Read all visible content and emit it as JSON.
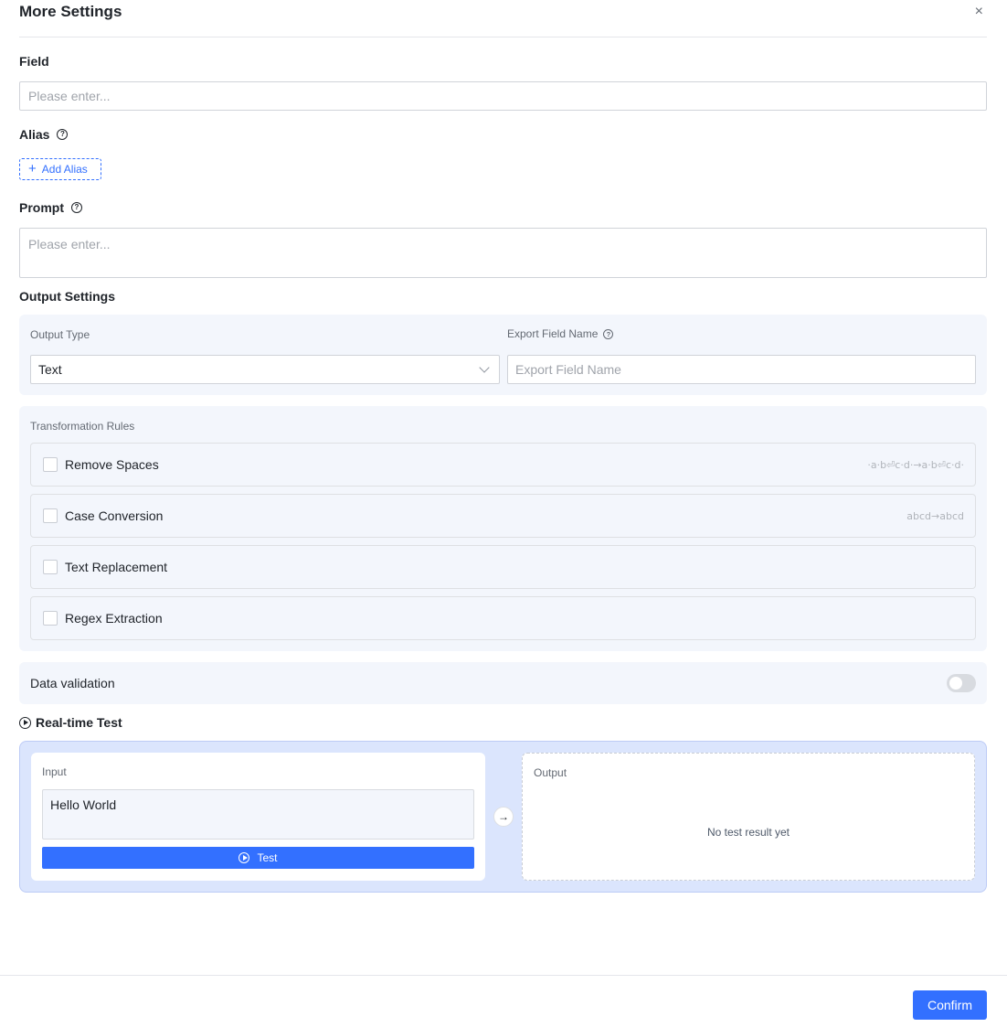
{
  "dialog": {
    "title": "More Settings",
    "close_glyph": "×"
  },
  "field": {
    "label": "Field",
    "placeholder": "Please enter..."
  },
  "alias": {
    "label": "Alias",
    "add_button": "Add Alias"
  },
  "prompt": {
    "label": "Prompt",
    "placeholder": "Please enter..."
  },
  "output_settings": {
    "label": "Output Settings",
    "output_type_label": "Output Type",
    "output_type_value": "Text",
    "export_field_label": "Export Field Name",
    "export_field_placeholder": "Export Field Name"
  },
  "transformation": {
    "label": "Transformation Rules",
    "rules": [
      {
        "label": "Remove Spaces",
        "hint": "·a·b⏎c·d·→a·b⏎c·d·",
        "checked": false
      },
      {
        "label": "Case Conversion",
        "hint": "abcd→abcd",
        "checked": false
      },
      {
        "label": "Text Replacement",
        "hint": "",
        "checked": false
      },
      {
        "label": "Regex Extraction",
        "hint": "",
        "checked": false
      }
    ]
  },
  "validation": {
    "label": "Data validation",
    "enabled": false
  },
  "realtime_test": {
    "title": "Real-time Test",
    "input_label": "Input",
    "input_value": "Hello World",
    "test_button": "Test",
    "output_label": "Output",
    "empty_text": "No test result yet"
  },
  "footer": {
    "confirm": "Confirm"
  },
  "colors": {
    "accent": "#3370ff",
    "panel": "#f3f6fc",
    "test_area": "#dbe5fd"
  }
}
